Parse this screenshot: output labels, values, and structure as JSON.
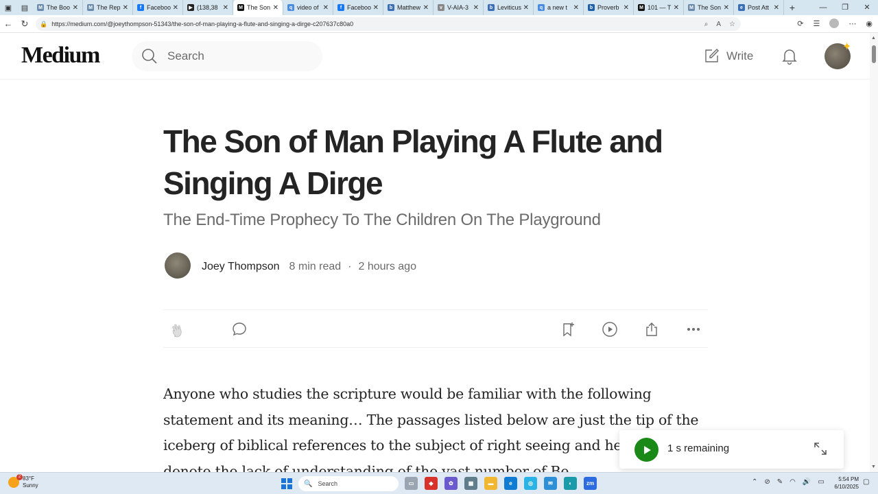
{
  "browser": {
    "tabs": [
      {
        "label": "The Boo",
        "favicon": "M",
        "color": "#6a8bab"
      },
      {
        "label": "The Rep",
        "favicon": "M",
        "color": "#6a8bab"
      },
      {
        "label": "Faceboo",
        "favicon": "f",
        "color": "#1877f2"
      },
      {
        "label": "(138,38",
        "favicon": "▶",
        "color": "#222"
      },
      {
        "label": "The Son",
        "favicon": "M",
        "color": "#111",
        "active": true
      },
      {
        "label": "video of",
        "favicon": "q",
        "color": "#4a8de0"
      },
      {
        "label": "Faceboo",
        "favicon": "f",
        "color": "#1877f2"
      },
      {
        "label": "Matthew",
        "favicon": "b",
        "color": "#3b6fb5"
      },
      {
        "label": "V-AIA-3",
        "favicon": "v",
        "color": "#888"
      },
      {
        "label": "Leviticus",
        "favicon": "b",
        "color": "#3b6fb5"
      },
      {
        "label": "a new t",
        "favicon": "q",
        "color": "#4a8de0"
      },
      {
        "label": "Proverb",
        "favicon": "b",
        "color": "#1d5fa8"
      },
      {
        "label": "101 — T",
        "favicon": "M",
        "color": "#111"
      },
      {
        "label": "The Son",
        "favicon": "M",
        "color": "#6a8bab"
      },
      {
        "label": "Post Att",
        "favicon": "e",
        "color": "#3b6fb5"
      }
    ],
    "url": "https://medium.com/@joeythompson-51343/the-son-of-man-playing-a-flute-and-singing-a-dirge-c207637c80a0"
  },
  "header": {
    "logo": "Medium",
    "search_placeholder": "Search",
    "write_label": "Write"
  },
  "article": {
    "title": "The Son of Man Playing A Flute and Singing A Dirge",
    "subtitle": "The End-Time Prophecy To The Children On The Playground",
    "author": "Joey Thompson",
    "read_time": "8 min read",
    "separator": "·",
    "published": "2 hours ago",
    "body": "Anyone who studies the scripture would be familiar with the following statement and its meaning… The passages listed below are just the tip of the iceberg of biblical references to the subject of right seeing and hearing, which denote the lack of understanding of the vast number of Be"
  },
  "player": {
    "remaining": "1 s remaining"
  },
  "taskbar": {
    "temp": "83°F",
    "condition": "Sunny",
    "weather_badge": "2",
    "search_label": "Search",
    "time": "5:54 PM",
    "date": "6/10/2025"
  },
  "colors": {
    "accent_green": "#1a8917",
    "text_primary": "#242424",
    "text_secondary": "#6b6b6b"
  }
}
